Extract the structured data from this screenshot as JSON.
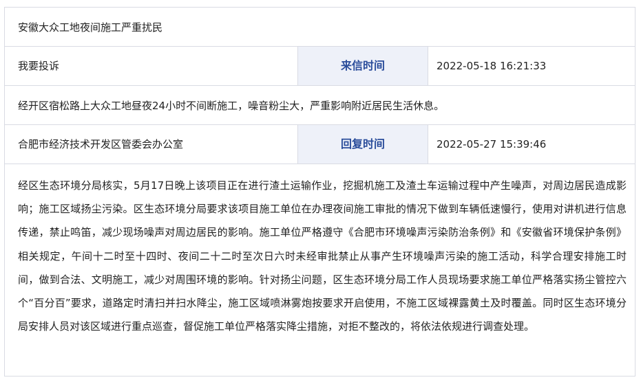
{
  "letter": {
    "title": "安徽大众工地夜间施工严重扰民",
    "complaint_type": "我要投诉",
    "sent_label": "来信时间",
    "sent_time": "2022-05-18 16:21:33",
    "content": "经开区宿松路上大众工地昼夜24小时不间断施工，噪音粉尘大，严重影响附近居民生活休息。",
    "responder": "合肥市经济技术开发区管委会办公室",
    "reply_label": "回复时间",
    "reply_time": "2022-05-27 15:39:46",
    "reply_content": "经区生态环境分局核实，5月17日晚上该项目正在进行渣土运输作业，挖掘机施工及渣土车运输过程中产生噪声，对周边居民造成影响；施工区域扬尘污染。区生态环境分局要求该项目施工单位在办理夜间施工审批的情况下做到车辆低速慢行，使用对讲机进行信息传递，禁止鸣笛，减少现场噪声对周边居民的影响。施工单位严格遵守《合肥市环境噪声污染防治条例》和《安徽省环境保护条例》相关规定，午间十二时至十四时、夜间二十二时至次日六时未经审批禁止从事产生环境噪声污染的施工活动，科学合理安排施工时间，做到合法、文明施工，减少对周围环境的影响。针对扬尘问题，区生态环境分局工作人员现场要求施工单位严格落实扬尘管控六个“百分百”要求，道路定时清扫并扫水降尘，施工区域喷淋雾炮按要求开启使用，不施工区域裸露黄土及时覆盖。同时区生态环境分局安排人员对该区域进行重点巡查，督促施工单位严格落实降尘措施，对拒不整改的，将依法依规进行调查处理。"
  }
}
